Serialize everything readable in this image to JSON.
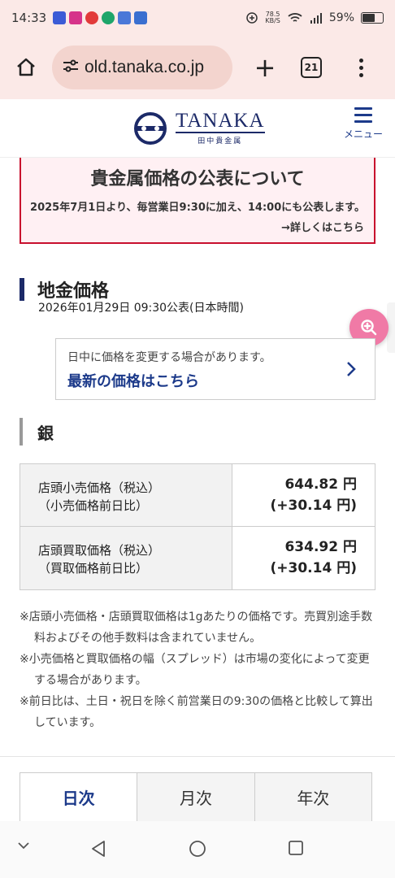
{
  "status_bar": {
    "time": "14:33",
    "speed_value": "78.5",
    "speed_unit": "KB/S",
    "battery": "59%",
    "battery_level": 0.59
  },
  "browser": {
    "url": "old.tanaka.co.jp",
    "tab_count": "21"
  },
  "header": {
    "logo_en": "TANAKA",
    "logo_jp": "田中貴金属",
    "menu_label": "メニュー",
    "brand_color": "#1c2a68"
  },
  "notice": {
    "title": "貴金属価格の公表について",
    "body": "2025年7月1日より、毎営業日9:30に加え、14:00にも公表します。",
    "link": "→詳しくはこちら",
    "border_color": "#c8102e"
  },
  "section": {
    "title": "地金価格",
    "published": "2026年01月29日 09:30公表(日本時間)"
  },
  "update_card": {
    "subtitle": "日中に価格を変更する場合があります。",
    "link": "最新の価格はこちら"
  },
  "metal": {
    "name": "銀"
  },
  "prices": [
    {
      "label_line1": "店頭小売価格（税込）",
      "label_line2": "（小売価格前日比）",
      "value": "644.82 円",
      "change": "(+30.14 円)"
    },
    {
      "label_line1": "店頭買取価格（税込）",
      "label_line2": "（買取価格前日比）",
      "value": "634.92 円",
      "change": "(+30.14 円)"
    }
  ],
  "notes": [
    "※店頭小売価格・店頭買取価格は1gあたりの価格です。売買別途手数料およびその他手数料は含まれていません。",
    "※小売価格と買取価格の幅（スプレッド）は市場の変化によって変更する場合があります。",
    "※前日比は、土日・祝日を除く前営業日の9:30の価格と比較して算出しています。"
  ],
  "tabs": [
    {
      "label": "日次",
      "active": true
    },
    {
      "label": "月次",
      "active": false
    },
    {
      "label": "年次",
      "active": false
    }
  ],
  "icons": {
    "home": "home-icon",
    "site_settings": "tune-icon",
    "new_tab": "plus-icon",
    "more": "more-vert-icon",
    "menu": "hamburger-icon",
    "zoom": "zoom-in-icon",
    "chevron": "chevron-right-icon",
    "nav_down": "chevron-down-icon",
    "nav_back": "back-triangle-icon",
    "nav_home": "circle-home-icon",
    "nav_recents": "square-recents-icon"
  }
}
